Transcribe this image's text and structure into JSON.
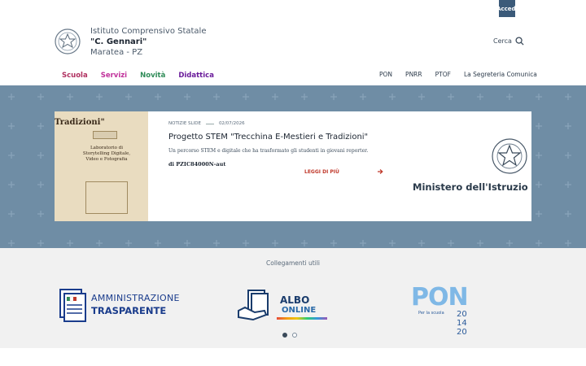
{
  "topbar": {
    "login_label": "Accedi",
    "login_color": "#3b5a79"
  },
  "header": {
    "school_line1": "Istituto Comprensivo Statale",
    "school_line2": "\"C. Gennari\"",
    "school_line3": "Maratea - PZ",
    "search_label": "Cerca",
    "search_icon": "search-icon"
  },
  "nav": {
    "primary": [
      {
        "label": "Scuola",
        "color": "#b03060"
      },
      {
        "label": "Servizi",
        "color": "#c0309a"
      },
      {
        "label": "Novità",
        "color": "#2e8b57"
      },
      {
        "label": "Didattica",
        "color": "#6a1b9a"
      }
    ],
    "secondary": [
      {
        "label": "PON"
      },
      {
        "label": "PNRR"
      },
      {
        "label": "PTOF"
      },
      {
        "label": "La Segreteria Comunica"
      }
    ]
  },
  "slider": {
    "thumb_title": "Tradizioni\"",
    "thumb_text": "Laboratorio di Storytelling Digitale, Video e Fotografia",
    "category": "NOTIZIE SLIDE",
    "date": "02/07/2026",
    "title": "Progetto STEM \"Trecchina E-Mestieri e Tradizioni\"",
    "description": "Un percorso STEM e digitale che ha trasformato gli studenti in giovani reporter.",
    "code": "di PZIC84000N-aut",
    "read_more": "LEGGI DI PIÙ",
    "ministry_text": "Ministero dell'Istruzio",
    "slide_count": 5,
    "active_slide": 1,
    "background_color": "#6f8da5"
  },
  "useful_links": {
    "title": "Collegamenti utili",
    "items": [
      {
        "line1": "AMMINISTRAZIONE",
        "line2": "TRASPARENTE"
      },
      {
        "line1": "ALBO",
        "line2": "ONLINE"
      },
      {
        "line1": "PON",
        "line2": "Per la scuola",
        "line3": "20 14 20"
      }
    ],
    "page_count": 2,
    "active_page": 1
  }
}
